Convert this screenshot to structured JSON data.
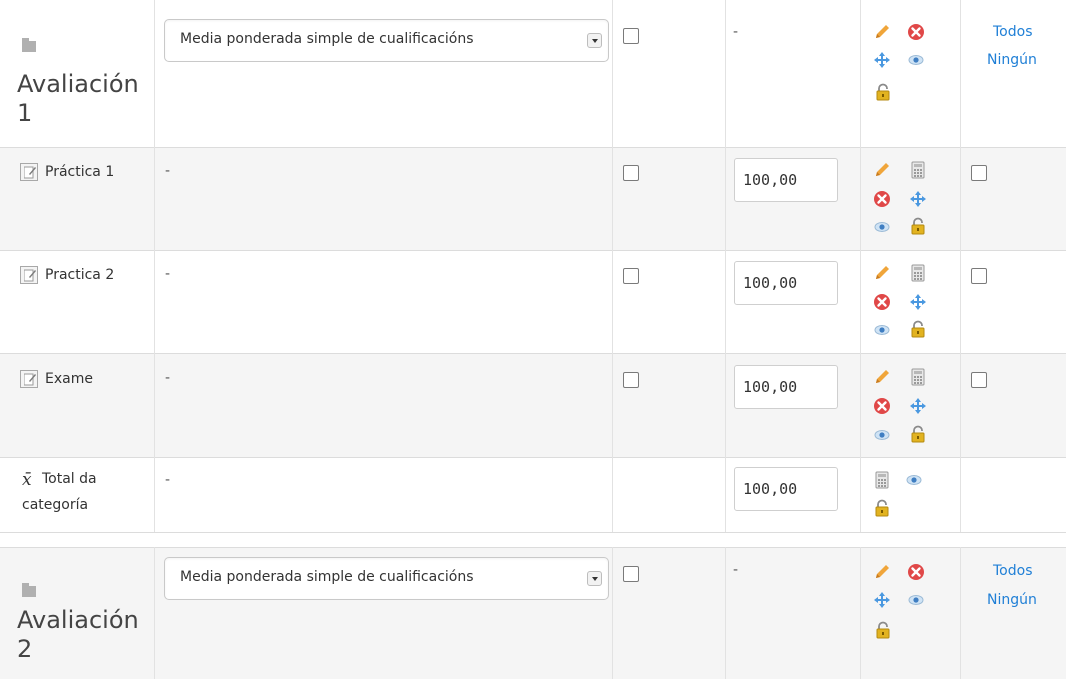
{
  "colors": {
    "row_alt": "#f5f5f5",
    "link": "#1f7fd6",
    "pencil": "#f0a53a",
    "delete": "#e04848",
    "move": "#4a98e0",
    "lock": "#e2b320"
  },
  "categories": [
    {
      "icon": "folder-icon",
      "name_line1": "Avaliación",
      "name_line2": "1",
      "aggregation": "Media ponderada simple de cualificacións",
      "weight": "-",
      "actions": [
        "edit-icon",
        "delete-icon",
        "move-icon",
        "show-hide-icon",
        "lock-icon"
      ],
      "select_all": "Todos",
      "select_none": "Ningún"
    },
    {
      "icon": "folder-icon",
      "name_line1": "Avaliación",
      "name_line2": "2",
      "aggregation": "Media ponderada simple de cualificacións",
      "weight": "-",
      "actions": [
        "edit-icon",
        "delete-icon",
        "move-icon",
        "show-hide-icon",
        "lock-icon"
      ],
      "select_all": "Todos",
      "select_none": "Ningún"
    }
  ],
  "items": [
    {
      "icon": "assignment-icon",
      "name": "Práctica 1",
      "aggregation": "-",
      "weight": "100,00",
      "actions": [
        "edit-icon",
        "calculator-icon",
        "delete-icon",
        "move-icon",
        "show-hide-icon",
        "lock-icon"
      ]
    },
    {
      "icon": "assignment-icon",
      "name": "Practica 2",
      "aggregation": "-",
      "weight": "100,00",
      "actions": [
        "edit-icon",
        "calculator-icon",
        "delete-icon",
        "move-icon",
        "show-hide-icon",
        "lock-icon"
      ]
    },
    {
      "icon": "assignment-icon",
      "name": "Exame",
      "aggregation": "-",
      "weight": "100,00",
      "actions": [
        "edit-icon",
        "calculator-icon",
        "delete-icon",
        "move-icon",
        "show-hide-icon",
        "lock-icon"
      ]
    }
  ],
  "total": {
    "icon": "sigma-icon",
    "icon_glyph": "x̄",
    "name_line1": "Total da",
    "name_line2": "categoría",
    "aggregation": "-",
    "weight": "100,00",
    "actions": [
      "calculator-icon",
      "show-hide-icon",
      "lock-icon"
    ]
  }
}
